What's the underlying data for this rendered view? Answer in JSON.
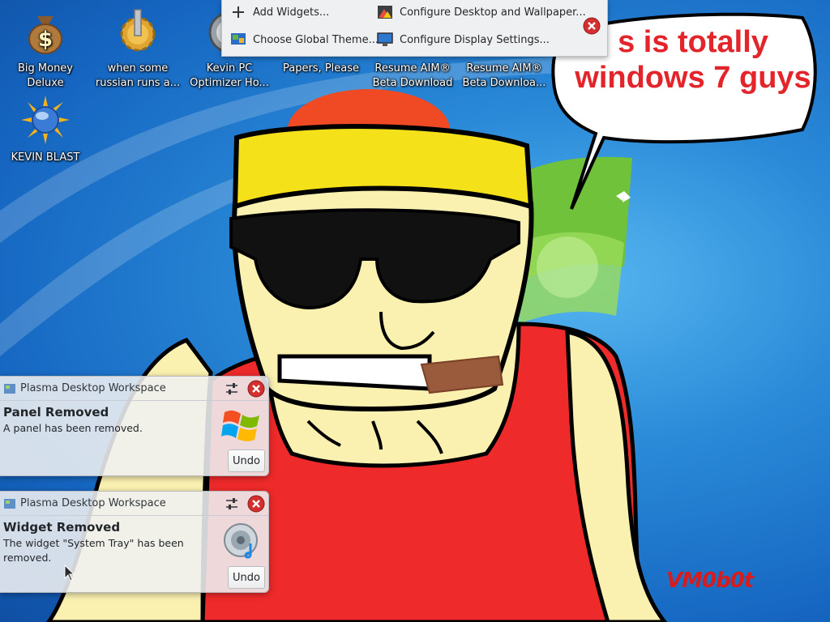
{
  "desktop": {
    "icons": [
      {
        "label": "Big Money Deluxe",
        "icon": "money-bag-icon"
      },
      {
        "label": "when some russian runs a...",
        "icon": "gear-icon"
      },
      {
        "label": "Kevin PC Optimizer Ho...",
        "icon": "optimizer-icon"
      },
      {
        "label": "Papers, Please",
        "icon": "papers-icon"
      },
      {
        "label": "Resume AIM® Beta Download",
        "icon": "aim-icon"
      },
      {
        "label": "Resume AIM® Beta Downloa...",
        "icon": "aim-icon"
      },
      {
        "label": "KEVIN BLAST",
        "icon": "blast-icon"
      }
    ]
  },
  "context_menu": {
    "items": [
      {
        "label": "Add Widgets...",
        "icon": "plus-icon"
      },
      {
        "label": "Configure Desktop and Wallpaper...",
        "icon": "desktop-config-icon"
      },
      {
        "label": "Choose Global Theme...",
        "icon": "theme-icon"
      },
      {
        "label": "Configure Display Settings...",
        "icon": "display-icon"
      }
    ]
  },
  "wallpaper": {
    "speech_line1": "s is totally",
    "speech_line2": "windows 7 guys",
    "signature": "VM0b0t"
  },
  "notifications": [
    {
      "app": "Plasma Desktop Workspace",
      "title": "Panel Removed",
      "body": "A panel has been removed.",
      "action": "Undo",
      "icon": "windows-logo-icon"
    },
    {
      "app": "Plasma Desktop Workspace",
      "title": "Widget Removed",
      "body": "The widget \"System Tray\" has been removed.",
      "action": "Undo",
      "icon": "speaker-icon"
    }
  ],
  "colors": {
    "desktop_blue": "#1a73c9",
    "speech_red": "#e3242b",
    "close_red": "#d32f2f",
    "menu_bg": "#eff0f1"
  }
}
